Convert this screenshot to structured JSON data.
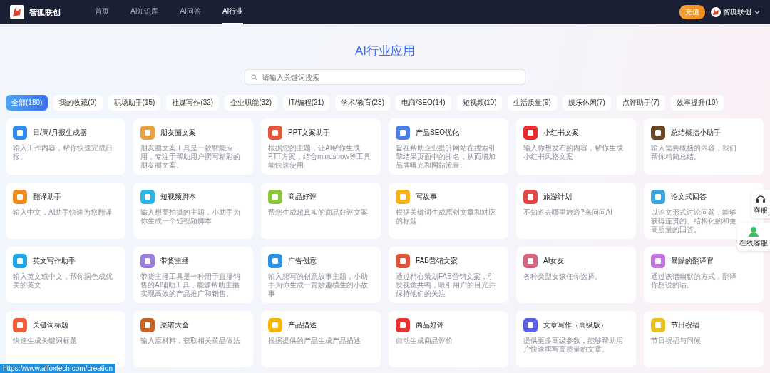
{
  "header": {
    "brand": "智狐联创",
    "nav": [
      {
        "label": "首页",
        "selected": false
      },
      {
        "label": "AI知识库",
        "selected": false
      },
      {
        "label": "AI问答",
        "selected": false
      },
      {
        "label": "AI行业",
        "selected": true
      }
    ],
    "recharge": "充值",
    "user": "智狐联创"
  },
  "page_title": "AI行业应用",
  "search": {
    "placeholder": "请输入关键词搜索"
  },
  "categories": [
    {
      "label": "全部(180)",
      "selected": true
    },
    {
      "label": "我的收藏(0)",
      "selected": false
    },
    {
      "label": "职场助手(15)",
      "selected": false
    },
    {
      "label": "社媒写作(32)",
      "selected": false
    },
    {
      "label": "企业职能(32)",
      "selected": false
    },
    {
      "label": "IT/编程(21)",
      "selected": false
    },
    {
      "label": "学术/教育(23)",
      "selected": false
    },
    {
      "label": "电商/SEO(14)",
      "selected": false
    },
    {
      "label": "短视频(10)",
      "selected": false
    },
    {
      "label": "生活质量(9)",
      "selected": false
    },
    {
      "label": "娱乐休闲(7)",
      "selected": false
    },
    {
      "label": "点评助手(7)",
      "selected": false
    },
    {
      "label": "效率提升(10)",
      "selected": false
    }
  ],
  "cards": [
    {
      "title": "日/周/月报生成器",
      "description": "输入工作内容，帮你快速完成日报。",
      "color": "#2f8cf0"
    },
    {
      "title": "朋友圈文案",
      "description": "朋友圈文案工具是一款智能应用，专注于帮助用户撰写精彩的朋友圈文案。",
      "color": "#e8a13c"
    },
    {
      "title": "PPT文案助手",
      "description": "根据您的主题，让AI帮你生成PTT方案，结合mindshow等工具能快速使用",
      "color": "#e5553a"
    },
    {
      "title": "产品SEO优化",
      "description": "旨在帮助企业提升网站在搜索引擎结果页面中的排名，从而增加品牌曝光和网站流量。",
      "color": "#4a7de8"
    },
    {
      "title": "小红书文案",
      "description": "输入你想发布的内容，帮你生成小红书风格文案",
      "color": "#e62b2b"
    },
    {
      "title": "总结概括小助手",
      "description": "输入需要概括的内容，我们帮你精简总结。",
      "color": "#6b4423"
    },
    {
      "title": "翻译助手",
      "description": "输入中文，AI助手快速为您翻译",
      "color": "#f08a1e"
    },
    {
      "title": "短视频脚本",
      "description": "输入想要拍摄的主题，小助手为你生成一个短视频脚本",
      "color": "#2ab7e8"
    },
    {
      "title": "商品好评",
      "description": "帮您生成超真实的商品好评文案",
      "color": "#8cc63f"
    },
    {
      "title": "写故事",
      "description": "根据关键词生成原创文章和对应的标题",
      "color": "#f5b21b"
    },
    {
      "title": "旅游计划",
      "description": "不知道去哪里旅游?来问问AI",
      "color": "#e24a4a"
    },
    {
      "title": "论文式回答",
      "description": "以论文形式讨论问题，能够获得连贯的、结构化的和更高质量的回答。",
      "color": "#3aa6dd"
    },
    {
      "title": "英文写作助手",
      "description": "输入英文或中文，帮你润色成优美的英文",
      "color": "#1fa7e8"
    },
    {
      "title": "带货主播",
      "description": "带货主播工具是一种用于直播销售的AI辅助工具，能够帮助主播实现高效的产品推广和销售。",
      "color": "#9b7de0"
    },
    {
      "title": "广告创意",
      "description": "输入想写的创意故事主题，小助手为你生成一篇妙趣横生的小故事",
      "color": "#2d8fe0"
    },
    {
      "title": "FAB营销文案",
      "description": "通过精心策划FAB营销文案，引发视觉共鸣，吸引用户的目光并保持他们的关注",
      "color": "#e0553a"
    },
    {
      "title": "AI女友",
      "description": "各种类型女孩任你选择。",
      "color": "#d9627f"
    },
    {
      "title": "暴躁的翻译官",
      "description": "通过诙谐幽默的方式，翻译你想说的话。",
      "color": "#c476e0"
    },
    {
      "title": "关键词标题",
      "description": "快速生成关键词标题",
      "color": "#f05a3a"
    },
    {
      "title": "菜谱大全",
      "description": "输入原材料，获取相关菜品做法",
      "color": "#c9621e"
    },
    {
      "title": "产品描述",
      "description": "根据提供的产品生成产品描述",
      "color": "#f5b800"
    },
    {
      "title": "商品好评",
      "description": "自动生成商品评价",
      "color": "#e8322e"
    },
    {
      "title": "文章写作（高级版）",
      "description": "提供更多高级参数，能够帮助用户快速撰写高质量的文章。",
      "color": "#5a5ee0"
    },
    {
      "title": "节日祝福",
      "description": "节日祝福与问候",
      "color": "#e8c020"
    }
  ],
  "side_buttons": [
    {
      "label": "客服",
      "kind": "headset"
    },
    {
      "label": "在线客服",
      "kind": "agent"
    }
  ],
  "status_bar": {
    "url": "https://www.aifoxtech.com/creation"
  }
}
